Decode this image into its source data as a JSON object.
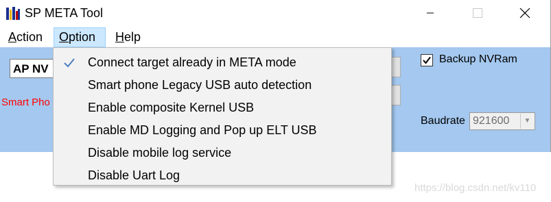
{
  "window": {
    "title": "SP META Tool",
    "icon": "sp-meta-app-icon",
    "controls": {
      "minimize_icon": "minimize-icon",
      "maximize_icon": "maximize-icon",
      "close_icon": "close-icon"
    }
  },
  "menubar": {
    "items": [
      {
        "label": "Action"
      },
      {
        "label": "Option",
        "state": "open"
      },
      {
        "label": "Help"
      }
    ]
  },
  "main": {
    "connection_combo_value": "AP NV",
    "status_label": "Smart Pho",
    "backup_nvram": {
      "label": "Backup NVRam",
      "checked": true
    },
    "baudrate": {
      "label": "Baudrate",
      "value": "921600",
      "disabled": true
    }
  },
  "option_menu": {
    "items": [
      {
        "label": "Connect target already in META mode",
        "checked": true
      },
      {
        "label": "Smart phone Legacy USB auto detection",
        "checked": false
      },
      {
        "label": "Enable composite Kernel USB",
        "checked": false
      },
      {
        "label": "Enable MD Logging and Pop up ELT USB",
        "checked": false
      },
      {
        "label": "Disable mobile log service",
        "checked": false
      },
      {
        "label": "Disable Uart Log",
        "checked": false
      }
    ]
  },
  "watermark": "https://blog.csdn.net/kv110",
  "colors": {
    "client_background": "#a4c8ef",
    "menu_highlight": "#cce8ff",
    "check_accent": "#4a7fc1",
    "status_text": "#ff0000"
  }
}
